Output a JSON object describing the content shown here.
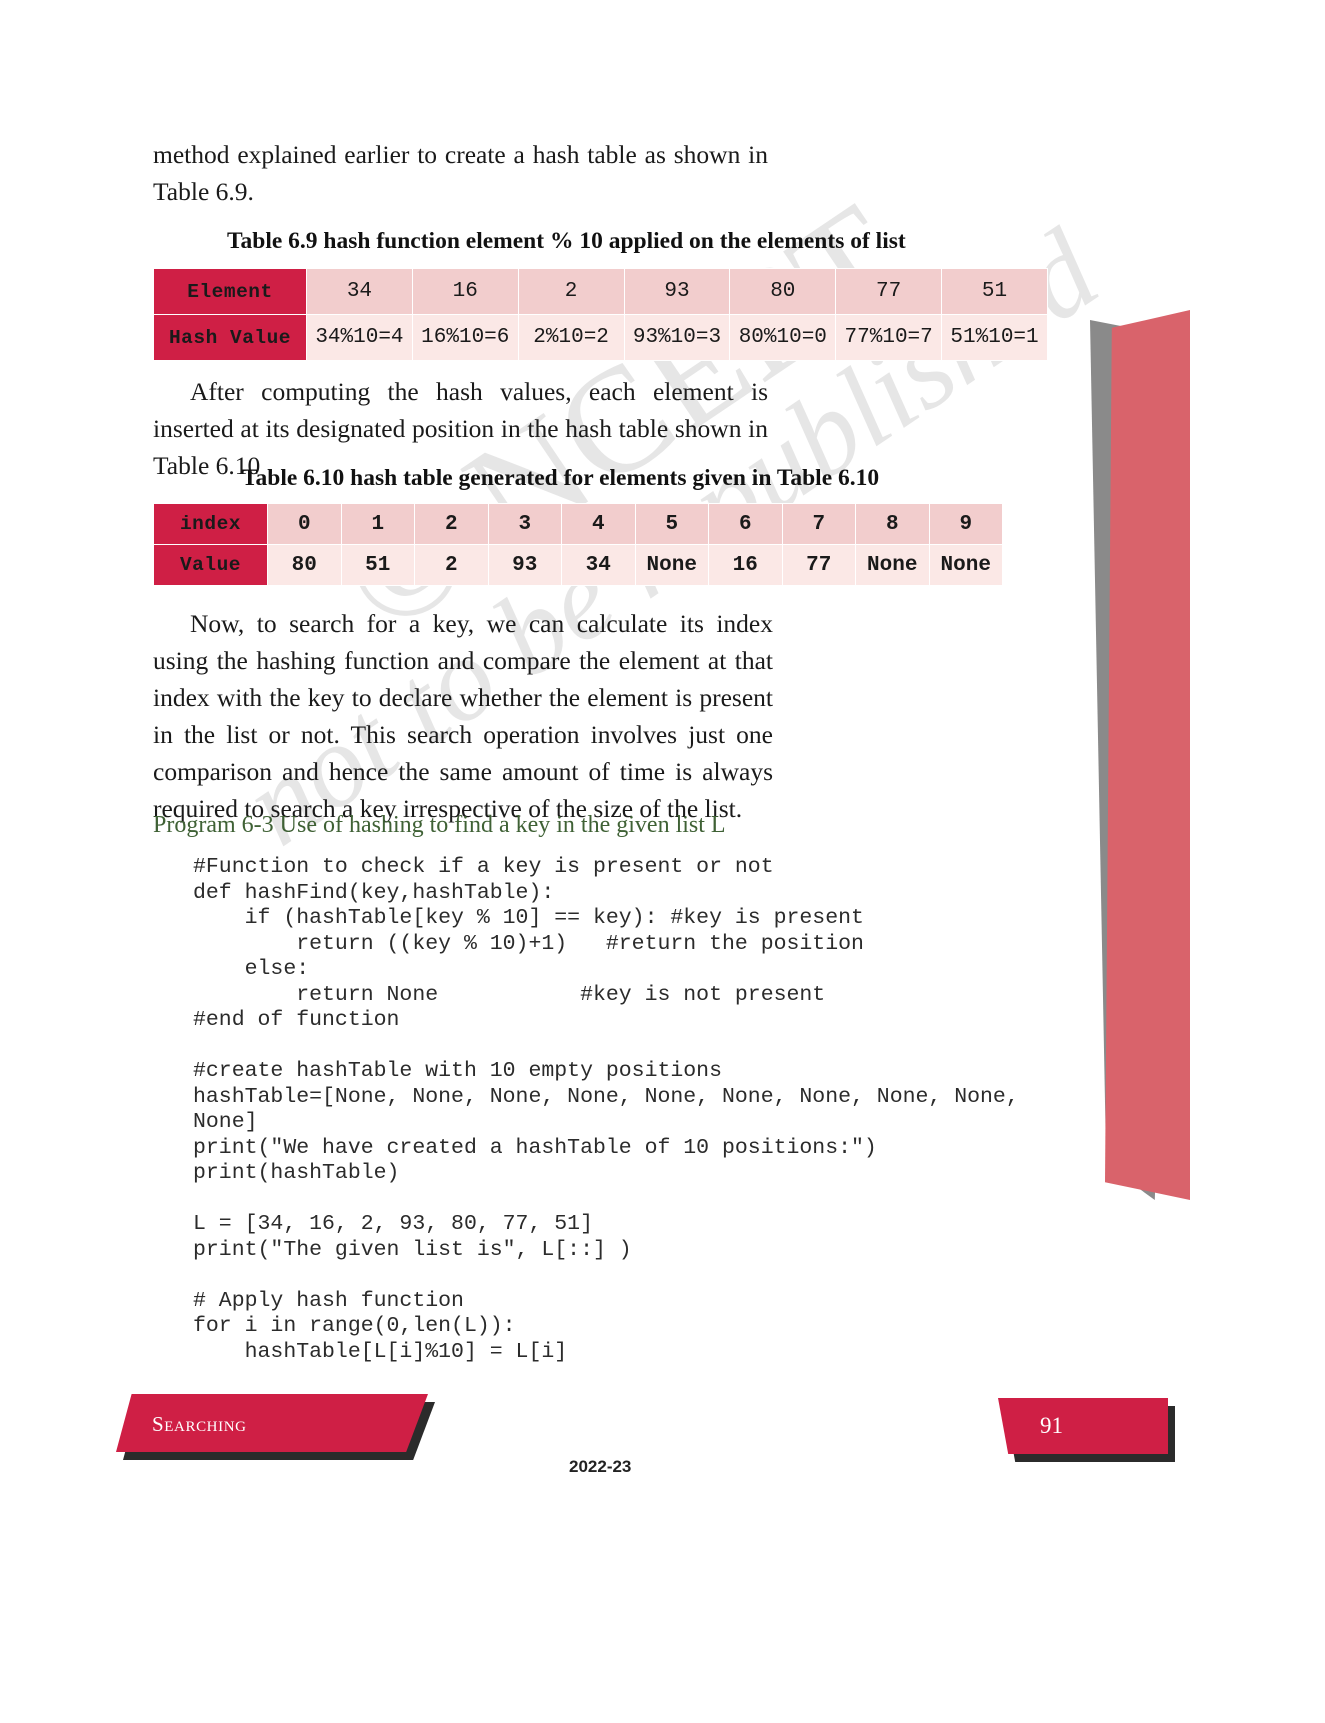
{
  "colors": {
    "header_crimson": "#cf1f45",
    "cell_pink_dark": "#f2cdcd",
    "cell_pink_light": "#fbe8e6",
    "program_green": "#3f6135",
    "edge_red": "#d9636b",
    "edge_gray": "#8a8a8a"
  },
  "watermark": {
    "line1": "not to be republished",
    "line2": "© NCERT"
  },
  "paragraphs": {
    "intro": "method explained earlier to create a hash table as shown in Table 6.9.",
    "after_t69": "After computing the hash values, each element is inserted at its designated position in the hash table shown in Table 6.10",
    "after_t610": "Now, to search for a key, we can calculate its index using the hashing function and compare the element at that index with the key to declare whether the element is present in the list or not. This search operation involves just one comparison and hence the same amount of time is always required to search a key irrespective of the size of the list."
  },
  "table_69": {
    "caption": "Table 6.9 hash function element % 10 applied on the elements of list",
    "rows": [
      {
        "header": "Element",
        "cells": [
          "34",
          "16",
          "2",
          "93",
          "80",
          "77",
          "51"
        ]
      },
      {
        "header": "Hash Value",
        "cells": [
          "34%10=4",
          "16%10=6",
          "2%10=2",
          "93%10=3",
          "80%10=0",
          "77%10=7",
          "51%10=1"
        ]
      }
    ]
  },
  "table_610": {
    "caption": "Table 6.10   hash table generated for elements given in Table 6.10",
    "rows": [
      {
        "header": "index",
        "cells": [
          "0",
          "1",
          "2",
          "3",
          "4",
          "5",
          "6",
          "7",
          "8",
          "9"
        ]
      },
      {
        "header": "Value",
        "cells": [
          "80",
          "51",
          "2",
          "93",
          "34",
          "None",
          "16",
          "77",
          "None",
          "None"
        ]
      }
    ]
  },
  "program": {
    "heading": "Program 6-3 Use of hashing to find a key in the given list L",
    "code": "#Function to check if a key is present or not\ndef hashFind(key,hashTable):\n    if (hashTable[key % 10] == key): #key is present\n        return ((key % 10)+1)   #return the position\n    else:\n        return None           #key is not present\n#end of function\n\n#create hashTable with 10 empty positions\nhashTable=[None, None, None, None, None, None, None, None, None,\nNone]\nprint(\"We have created a hashTable of 10 positions:\")\nprint(hashTable)\n\nL = [34, 16, 2, 93, 80, 77, 51]\nprint(\"The given list is\", L[::] )\n\n# Apply hash function\nfor i in range(0,len(L)):\n    hashTable[L[i]%10] = L[i]"
  },
  "footer": {
    "chapter_label": "Searching",
    "page_number": "91",
    "year": "2022-23"
  }
}
